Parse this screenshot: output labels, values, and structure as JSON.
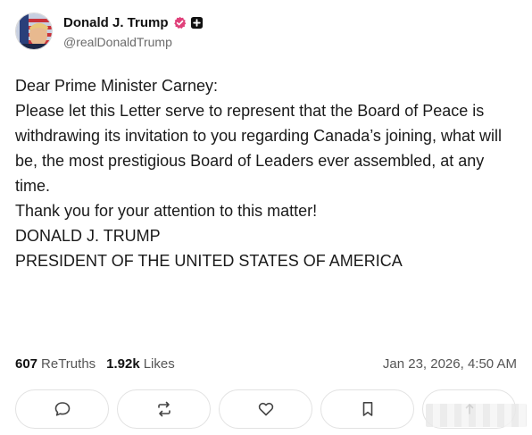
{
  "author": {
    "display_name": "Donald J. Trump",
    "handle": "@realDonaldTrump",
    "verified_icon": "verified-badge-icon",
    "plus_icon": "plus-square-icon"
  },
  "post": {
    "salutation": "Dear Prime Minister Carney:",
    "paragraph_1": "Please let this Letter serve to represent that the Board of Peace is withdrawing its invitation to you regarding Canada’s joining, what will be, the most prestigious Board of Leaders ever assembled, at any time.",
    "paragraph_2": "Thank you for your attention to this matter!",
    "signature_name": "DONALD J. TRUMP",
    "signature_title": "PRESIDENT OF THE UNITED STATES OF AMERICA"
  },
  "stats": {
    "retruths_count": "607",
    "retruths_label": "ReTruths",
    "likes_count": "1.92k",
    "likes_label": "Likes",
    "timestamp": "Jan 23, 2026, 4:50 AM"
  },
  "actions": [
    {
      "icon": "reply-icon"
    },
    {
      "icon": "retruth-icon"
    },
    {
      "icon": "like-heart-icon"
    },
    {
      "icon": "bookmark-icon"
    },
    {
      "icon": "share-icon"
    }
  ],
  "colors": {
    "verified": "#e0407a",
    "text": "#1a1a1a",
    "muted": "#555555",
    "border": "#e2e2e2"
  }
}
